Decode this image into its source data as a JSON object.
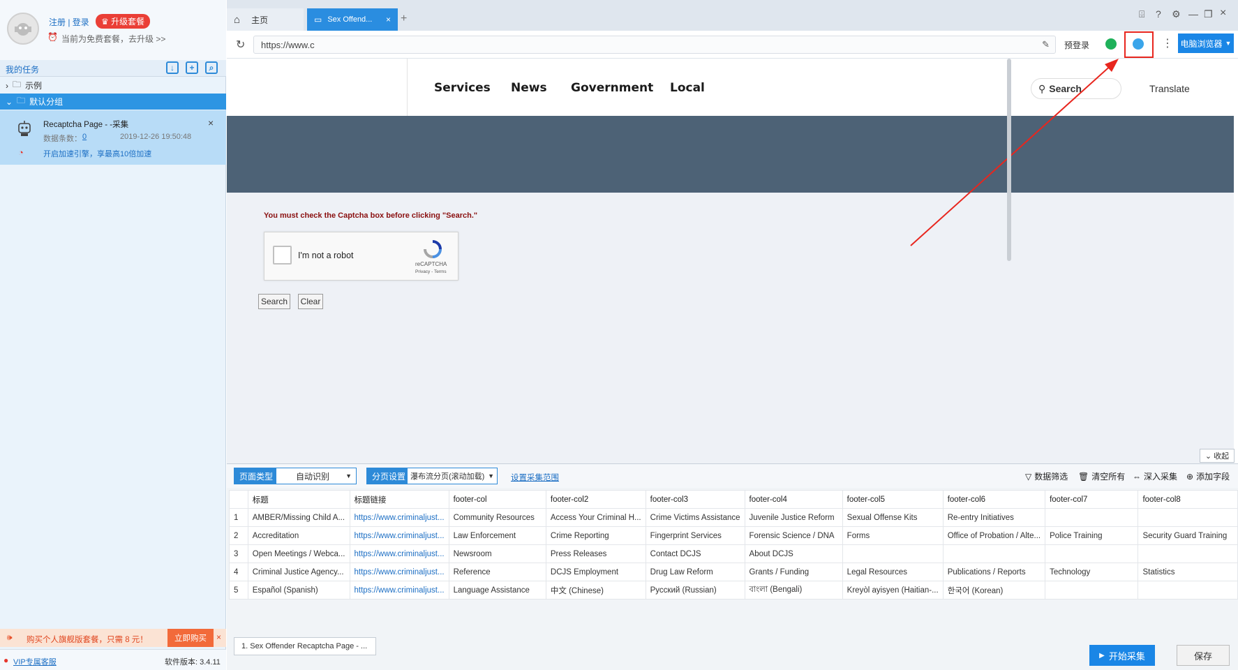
{
  "left_panel": {
    "login_links": "注册 | 登录",
    "upgrade_badge": "升级套餐",
    "plan_notice": "当前为免费套餐，去升级 >>",
    "tasks_title": "我的任务",
    "tree": [
      {
        "label": "示例"
      },
      {
        "label": "默认分组"
      }
    ],
    "task": {
      "title": "Recaptcha Page - -采集",
      "count_label": "数据条数：",
      "count": "0",
      "timestamp": "2019-12-26 19:50:48",
      "boost": "开启加速引擎，享最高10倍加速"
    },
    "promo_text": "购买个人旗舰版套餐，只需 8 元！",
    "buy_now": "立即购买",
    "vip_support": "VIP专属客服",
    "version": "软件版本: 3.4.11"
  },
  "browser": {
    "tabs": [
      {
        "label": "主页"
      },
      {
        "label": "Sex Offend..."
      }
    ],
    "new_tab": "+",
    "url": "https://www.c",
    "pre_login": "预登录",
    "mode_button": "电脑浏览器"
  },
  "page": {
    "nav": [
      "Services",
      "News",
      "Government",
      "Local"
    ],
    "search_label": "Search",
    "translate": "Translate",
    "warning": "You must check the Captcha box before clicking \"Search.\"",
    "captcha_label": "I'm not a robot",
    "captcha_brand": "reCAPTCHA",
    "captcha_terms": "Privacy - Terms",
    "search_button": "Search",
    "clear_button": "Clear"
  },
  "bottom": {
    "collapse": "收起",
    "page_type_label": "页面类型",
    "page_type_value": "自动识别",
    "pagination_label": "分页设置",
    "pagination_value": "瀑布流分页(滚动加载)",
    "set_range": "设置采集范围",
    "tools": [
      "数据筛选",
      "清空所有",
      "深入采集",
      "添加字段"
    ],
    "columns": [
      "标题",
      "标题链接",
      "footer-col",
      "footer-col2",
      "footer-col3",
      "footer-col4",
      "footer-col5",
      "footer-col6",
      "footer-col7",
      "footer-col8"
    ],
    "rows": [
      [
        "AMBER/Missing Child A...",
        "https://www.criminaljust...",
        "Community Resources",
        "Access Your Criminal H...",
        "Crime Victims Assistance",
        "Juvenile Justice Reform",
        "Sexual Offense Kits",
        "Re-entry Initiatives",
        "",
        ""
      ],
      [
        "Accreditation",
        "https://www.criminaljust...",
        "Law Enforcement",
        "Crime Reporting",
        "Fingerprint Services",
        "Forensic Science / DNA",
        "Forms",
        "Office of Probation / Alte...",
        "Police Training",
        "Security Guard Training"
      ],
      [
        "Open Meetings / Webca...",
        "https://www.criminaljust...",
        "Newsroom",
        "Press Releases",
        "Contact DCJS",
        "About DCJS",
        "",
        "",
        "",
        ""
      ],
      [
        "Criminal Justice Agency...",
        "https://www.criminaljust...",
        "Reference",
        "DCJS Employment",
        "Drug Law Reform",
        "Grants / Funding",
        "Legal Resources",
        "Publications / Reports",
        "Technology",
        "Statistics"
      ],
      [
        "Español (Spanish)",
        "https://www.criminaljust...",
        "Language Assistance",
        "中文 (Chinese)",
        "Русский (Russian)",
        "বাংলা (Bengali)",
        "Kreyòl ayisyen (Haitian-...",
        "한국어 (Korean)",
        "",
        ""
      ]
    ],
    "row_numbers": [
      "1",
      "2",
      "3",
      "4",
      "5"
    ],
    "sheet_tab": "1. Sex Offender Recaptcha Page - ...",
    "start_button": "开始采集",
    "save_button": "保存"
  },
  "colors": {
    "accent": "#1a86e6",
    "annotation": "#e8261e",
    "banner": "#4d6276"
  }
}
